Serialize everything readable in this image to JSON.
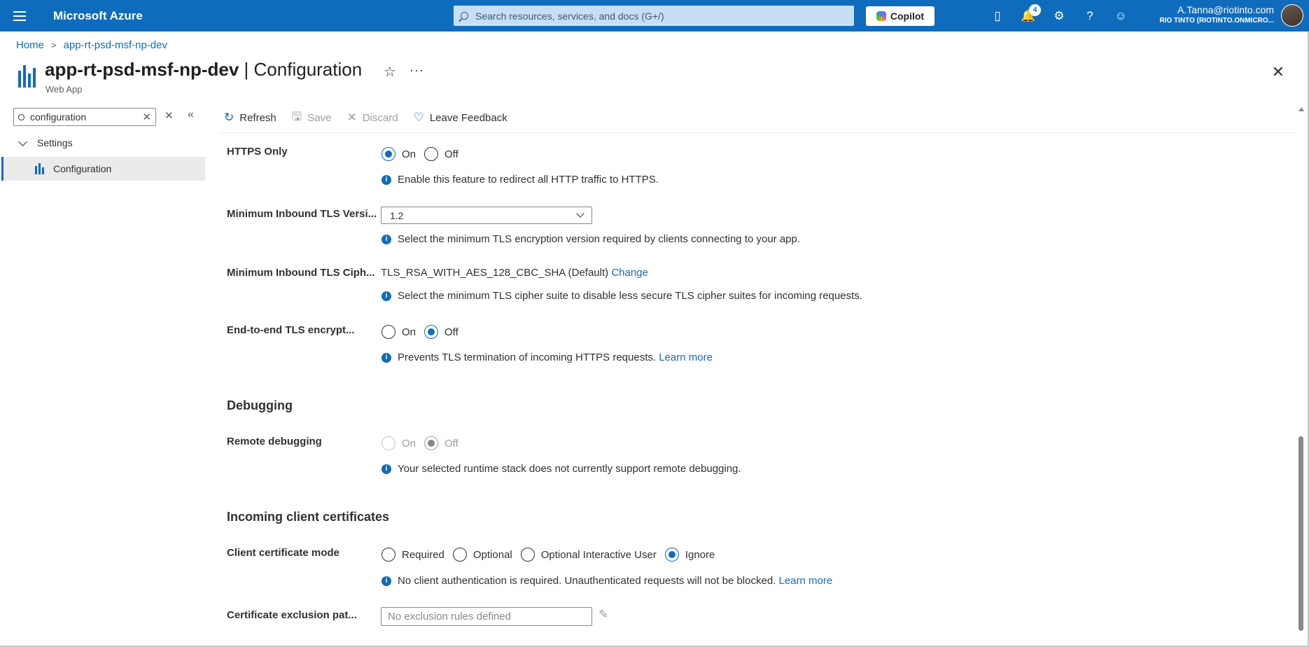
{
  "topbar": {
    "brand": "Microsoft Azure",
    "search_placeholder": "Search resources, services, and docs (G+/)",
    "copilot_label": "Copilot",
    "notification_count": "4",
    "user_email": "A.Tanna@riotinto.com",
    "user_tenant": "RIO TINTO (RIOTINTO.ONMICRO..."
  },
  "breadcrumb": [
    "Home",
    "app-rt-psd-msf-np-dev"
  ],
  "header": {
    "resource": "app-rt-psd-msf-np-dev",
    "separator": " | ",
    "blade": "Configuration",
    "subtitle": "Web App"
  },
  "menu": {
    "search_value": "configuration",
    "group": "Settings",
    "item": "Configuration"
  },
  "toolbar": {
    "refresh": "Refresh",
    "save": "Save",
    "discard": "Discard",
    "feedback": "Leave Feedback"
  },
  "settings": {
    "https_only": {
      "label": "HTTPS Only",
      "options": [
        "On",
        "Off"
      ],
      "selected": "On",
      "info": "Enable this feature to redirect all HTTP traffic to HTTPS."
    },
    "min_tls": {
      "label": "Minimum Inbound TLS Versi...",
      "value": "1.2",
      "info": "Select the minimum TLS encryption version required by clients connecting to your app."
    },
    "min_cipher": {
      "label": "Minimum Inbound TLS Ciph...",
      "value": "TLS_RSA_WITH_AES_128_CBC_SHA (Default)",
      "change": "Change",
      "info": "Select the minimum TLS cipher suite to disable less secure TLS cipher suites for incoming requests."
    },
    "e2e_tls": {
      "label": "End-to-end TLS encrypt...",
      "options": [
        "On",
        "Off"
      ],
      "selected": "Off",
      "info": "Prevents TLS termination of incoming HTTPS requests.",
      "learn_more": "Learn more"
    },
    "debugging_section": "Debugging",
    "remote_debugging": {
      "label": "Remote debugging",
      "options": [
        "On",
        "Off"
      ],
      "selected": "Off",
      "info": "Your selected runtime stack does not currently support remote debugging."
    },
    "certs_section": "Incoming client certificates",
    "client_cert_mode": {
      "label": "Client certificate mode",
      "options": [
        "Required",
        "Optional",
        "Optional Interactive User",
        "Ignore"
      ],
      "selected": "Ignore",
      "info": "No client authentication is required. Unauthenticated requests will not be blocked.",
      "learn_more": "Learn more"
    },
    "cert_exclusion": {
      "label": "Certificate exclusion pat...",
      "placeholder": "No exclusion rules defined"
    }
  },
  "colors": {
    "accent": "#0f6cbd",
    "topbar": "#0f6cbd",
    "selected_menu_bg": "#edebe9"
  }
}
